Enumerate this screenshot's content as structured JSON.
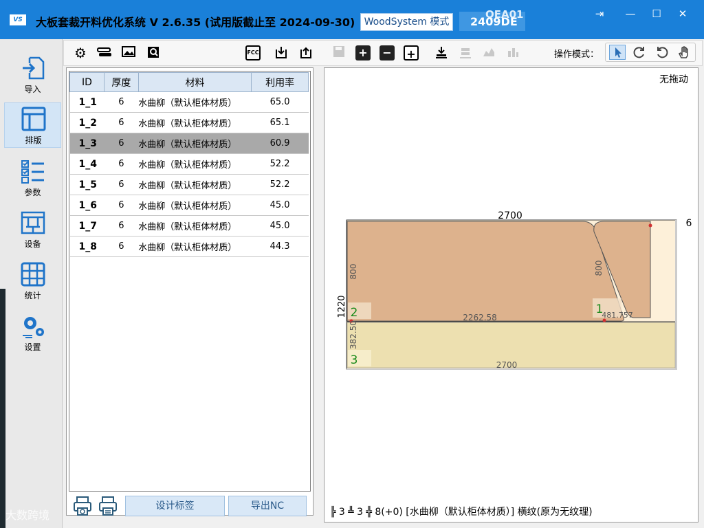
{
  "titlebar": {
    "logo": "VS",
    "title": "大板套裁开料优化系统  V 2.6.35  (试用版截止至 2024-09-30)",
    "mode": "WoodSystem 模式",
    "code_top": "QEA01",
    "code_main": "2409DE",
    "controls": [
      "⇥",
      "—",
      "☐",
      "✕"
    ]
  },
  "nav": [
    {
      "label": "导入",
      "icon": "import-icon"
    },
    {
      "label": "排版",
      "icon": "layout-icon",
      "active": true
    },
    {
      "label": "参数",
      "icon": "checklist-icon"
    },
    {
      "label": "设备",
      "icon": "machine-icon"
    },
    {
      "label": "统计",
      "icon": "grid-icon"
    },
    {
      "label": "设置",
      "icon": "gears-icon"
    }
  ],
  "toolbar": {
    "mode_label": "操作模式：",
    "fcc": "FCC"
  },
  "table": {
    "headers": [
      "ID",
      "厚度",
      "材料",
      "利用率"
    ],
    "rows": [
      {
        "id": "1_1",
        "thick": "6",
        "material": "水曲柳（默认柜体材质）",
        "rate": "65.0"
      },
      {
        "id": "1_2",
        "thick": "6",
        "material": "水曲柳（默认柜体材质）",
        "rate": "65.1"
      },
      {
        "id": "1_3",
        "thick": "6",
        "material": "水曲柳（默认柜体材质）",
        "rate": "60.9",
        "selected": true
      },
      {
        "id": "1_4",
        "thick": "6",
        "material": "水曲柳（默认柜体材质）",
        "rate": "52.2"
      },
      {
        "id": "1_5",
        "thick": "6",
        "material": "水曲柳（默认柜体材质）",
        "rate": "52.2"
      },
      {
        "id": "1_6",
        "thick": "6",
        "material": "水曲柳（默认柜体材质）",
        "rate": "45.0"
      },
      {
        "id": "1_7",
        "thick": "6",
        "material": "水曲柳（默认柜体材质）",
        "rate": "45.0"
      },
      {
        "id": "1_8",
        "thick": "6",
        "material": "水曲柳（默认柜体材质）",
        "rate": "44.3"
      }
    ]
  },
  "buttons": {
    "design_label": "设计标签",
    "export_nc": "导出NC"
  },
  "canvas": {
    "drag_mode": "无拖动",
    "board_width": "2700",
    "board_height": "1220",
    "thickness": "6",
    "part1_label": "1",
    "part1_height": "800",
    "part1_offset": "481.757",
    "part2_label": "2",
    "part2_height": "800",
    "part2_width": "2262.58",
    "part3_label": "3",
    "part3_height": "382.50",
    "part3_width": "2700"
  },
  "status": "╠ 3 ╩ 3  ╬ 8(+0)   [水曲柳（默认柜体材质）] 横纹(原为无纹理)",
  "watermark": "大数跨境",
  "colors": {
    "titlebar": "#1a80d9",
    "part_brown": "#ddb28d",
    "part_yellow": "#ede0b0",
    "board_bg": "#fdf0d9"
  }
}
